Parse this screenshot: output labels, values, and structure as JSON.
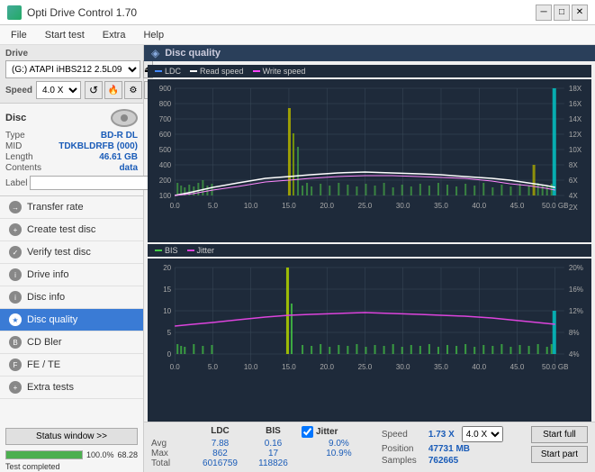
{
  "titlebar": {
    "title": "Opti Drive Control 1.70",
    "icon": "disc-icon",
    "controls": [
      "minimize",
      "maximize",
      "close"
    ]
  },
  "menubar": {
    "items": [
      "File",
      "Start test",
      "Extra",
      "Help"
    ]
  },
  "drive": {
    "label": "Drive",
    "selector_value": "(G:) ATAPI iHBS212  2.5L09",
    "speed_label": "Speed",
    "speed_value": "4.0 X"
  },
  "disc": {
    "title": "Disc",
    "type_label": "Type",
    "type_value": "BD-R DL",
    "mid_label": "MID",
    "mid_value": "TDKBLDRFB (000)",
    "length_label": "Length",
    "length_value": "46.61 GB",
    "contents_label": "Contents",
    "contents_value": "data",
    "label_label": "Label",
    "label_value": ""
  },
  "nav": {
    "items": [
      {
        "id": "transfer-rate",
        "label": "Transfer rate",
        "active": false
      },
      {
        "id": "create-test-disc",
        "label": "Create test disc",
        "active": false
      },
      {
        "id": "verify-test-disc",
        "label": "Verify test disc",
        "active": false
      },
      {
        "id": "drive-info",
        "label": "Drive info",
        "active": false
      },
      {
        "id": "disc-info",
        "label": "Disc info",
        "active": false
      },
      {
        "id": "disc-quality",
        "label": "Disc quality",
        "active": true
      },
      {
        "id": "cd-bler",
        "label": "CD Bler",
        "active": false
      },
      {
        "id": "fe-te",
        "label": "FE / TE",
        "active": false
      },
      {
        "id": "extra-tests",
        "label": "Extra tests",
        "active": false
      }
    ]
  },
  "status": {
    "button_label": "Status window >>",
    "progress": 100,
    "progress_text": "100.0%",
    "status_text": "Test completed",
    "extra_value": "68.28"
  },
  "chart": {
    "title": "Disc quality",
    "legend_top": [
      {
        "label": "LDC",
        "color": "#4488ff"
      },
      {
        "label": "Read speed",
        "color": "#ffffff"
      },
      {
        "label": "Write speed",
        "color": "#ff44ff"
      }
    ],
    "legend_bottom": [
      {
        "label": "BIS",
        "color": "#44cc44"
      },
      {
        "label": "Jitter",
        "color": "#dd44dd"
      }
    ],
    "top_ymax": 900,
    "top_ymin": 100,
    "bottom_ymax": 20,
    "bottom_ymin": 0,
    "xmax": 50
  },
  "stats": {
    "col_headers": [
      "",
      "LDC",
      "BIS",
      ""
    ],
    "jitter_label": "Jitter",
    "jitter_checked": true,
    "speed_label": "Speed",
    "speed_value": "1.73 X",
    "speed_select": "4.0 X",
    "avg_label": "Avg",
    "avg_ldc": "7.88",
    "avg_bis": "0.16",
    "avg_jitter": "9.0%",
    "max_label": "Max",
    "max_ldc": "862",
    "max_bis": "17",
    "max_jitter": "10.9%",
    "total_label": "Total",
    "total_ldc": "6016759",
    "total_bis": "118826",
    "position_label": "Position",
    "position_value": "47731 MB",
    "samples_label": "Samples",
    "samples_value": "762665",
    "start_full": "Start full",
    "start_part": "Start part"
  }
}
